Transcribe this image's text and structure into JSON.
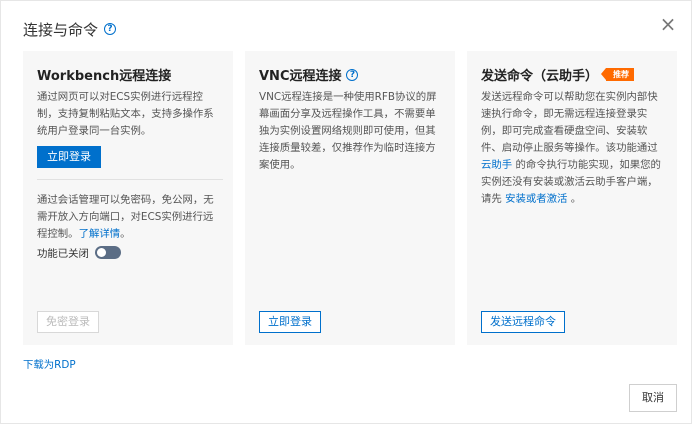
{
  "dialog": {
    "title": "连接与命令",
    "close_glyph": "×",
    "help_glyph": "?"
  },
  "workbench": {
    "title": "Workbench远程连接",
    "desc": "通过网页可以对ECS实例进行远程控制，支持复制粘贴文本，支持多操作系统用户登录同一台实例。",
    "login_label": "立即登录",
    "session_desc": "通过会话管理可以免密码，免公网，无需开放入方向端口，对ECS实例进行远程控制。",
    "learn_more": "了解详情",
    "toggle_label": "功能已关闭",
    "passwordless_label": "免密登录"
  },
  "vnc": {
    "title": "VNC远程连接",
    "desc": "VNC远程连接是一种使用RFB协议的屏幕画面分享及远程操作工具，不需要单独为实例设置网络规则即可使用，但其连接质量较差，仅推荐作为临时连接方案使用。",
    "login_label": "立即登录"
  },
  "command": {
    "title": "发送命令（云助手）",
    "badge": "推荐",
    "desc_part1": "发送远程命令可以帮助您在实例内部快速执行命令，即无需远程连接登录实例，即可完成查看硬盘空间、安装软件、启动停止服务等操作。该功能通过",
    "link_assistant": "云助手",
    "desc_part2": "的命令执行功能实现，如果您的实例还没有安装或激活云助手客户端，请先",
    "link_install": "安装或者激活",
    "desc_part3": "。",
    "send_label": "发送远程命令"
  },
  "footer": {
    "rdp_link": "下载为RDP",
    "cancel_label": "取消"
  },
  "colors": {
    "accent": "#0070cc",
    "badge": "#ff6a00",
    "toggle_off": "#5b6d85"
  }
}
